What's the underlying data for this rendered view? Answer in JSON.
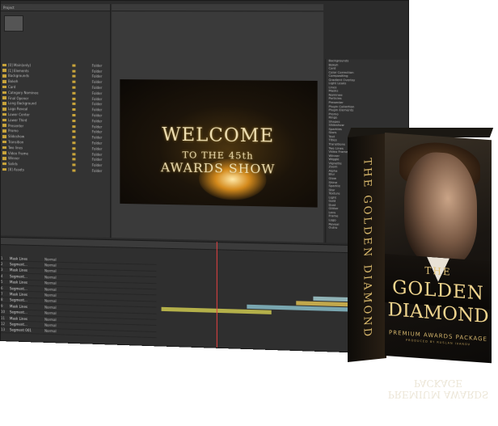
{
  "project_panel": {
    "tab": "Project",
    "columns": [
      "Name",
      "Type",
      "Size"
    ],
    "items": [
      {
        "name": "[0] Main(only)",
        "type": "Folder"
      },
      {
        "name": "[1] Elements",
        "type": "Folder"
      },
      {
        "name": "Backgrounds",
        "type": "Folder"
      },
      {
        "name": "Bokeh",
        "type": "Folder"
      },
      {
        "name": "Card",
        "type": "Folder"
      },
      {
        "name": "Category Nominee",
        "type": "Folder"
      },
      {
        "name": "Final Opener",
        "type": "Folder"
      },
      {
        "name": "Long Background",
        "type": "Folder"
      },
      {
        "name": "Logo Reveal",
        "type": "Folder"
      },
      {
        "name": "Lower Center",
        "type": "Folder"
      },
      {
        "name": "Lower Third",
        "type": "Folder"
      },
      {
        "name": "Presenter",
        "type": "Folder"
      },
      {
        "name": "Promo",
        "type": "Folder"
      },
      {
        "name": "Slideshow",
        "type": "Folder"
      },
      {
        "name": "Transition",
        "type": "Folder"
      },
      {
        "name": "Two lines",
        "type": "Folder"
      },
      {
        "name": "Video Frame",
        "type": "Folder"
      },
      {
        "name": "Winner",
        "type": "Folder"
      },
      {
        "name": "Solids",
        "type": "Folder"
      },
      {
        "name": "[8] Assets",
        "type": "Folder"
      }
    ]
  },
  "composition": {
    "line1": "WELCOME",
    "line2": "TO THE 45th",
    "line3": "AWARDS SHOW"
  },
  "timeline": {
    "columns": [
      "Source Name",
      "Mode",
      "TrkMat",
      "Parent"
    ],
    "layers": [
      {
        "num": "1",
        "name": "Mask Lines",
        "mode": "Normal"
      },
      {
        "num": "2",
        "name": "Segment...",
        "mode": "Normal"
      },
      {
        "num": "3",
        "name": "Mask Lines",
        "mode": "Normal"
      },
      {
        "num": "4",
        "name": "Segment...",
        "mode": "Normal"
      },
      {
        "num": "5",
        "name": "Mask Lines",
        "mode": "Normal"
      },
      {
        "num": "6",
        "name": "Segment...",
        "mode": "Normal"
      },
      {
        "num": "7",
        "name": "Mask Lines",
        "mode": "Normal"
      },
      {
        "num": "8",
        "name": "Segment...",
        "mode": "Normal"
      },
      {
        "num": "9",
        "name": "Mask Lines",
        "mode": "Normal"
      },
      {
        "num": "10",
        "name": "Segment...",
        "mode": "Normal"
      },
      {
        "num": "11",
        "name": "Mask Lines",
        "mode": "Normal"
      },
      {
        "num": "12",
        "name": "Segment...",
        "mode": "Normal"
      },
      {
        "num": "13",
        "name": "Segment 001",
        "mode": "Normal"
      }
    ],
    "track_bars": [
      {
        "start": 0.0,
        "end": 0.45,
        "color": "#b4b04a"
      },
      {
        "start": 0.35,
        "end": 0.9,
        "color": "#79a6b0"
      },
      {
        "start": 0.55,
        "end": 1.0,
        "color": "#c2a84c"
      },
      {
        "start": 0.62,
        "end": 1.0,
        "color": "#8fb2b6"
      }
    ]
  },
  "box": {
    "side": "THE GOLDEN DIAMOND",
    "the": "THE",
    "golden": "GOLDEN",
    "diamond": "DIAMOND",
    "subtitle": "PREMIUM AWARDS PACKAGE",
    "producer": "PRODUCED BY RUSLAN IVANOV"
  },
  "effects_panel": {
    "items": [
      "Backgrounds",
      "Bokeh",
      "Card",
      "Color Correction",
      "Compositing",
      "Gradient Overlay",
      "Light Leaks",
      "Lines",
      "Masks",
      "Nominee",
      "Particles",
      "Presenter",
      "Plugin Collection",
      "Plugin Elements",
      "Promo",
      "Rings",
      "Shapes",
      "Slideshow",
      "Sparkles",
      "Stars",
      "Text",
      "Titles",
      "Transitions",
      "Two Lines",
      "Video Frames",
      "Winner",
      "Wiggle",
      "Vignette",
      "Zoom",
      "Alpha",
      "Blur",
      "Glow",
      "Shine",
      "Sparkle",
      "Star",
      "Texture",
      "Light",
      "Gold",
      "Dust",
      "Glitter",
      "Lens",
      "Frame",
      "Logo",
      "Reveal",
      "Outro"
    ]
  },
  "colors": {
    "accent_gold": "#e3c47a",
    "ui_dark": "#2b2b2b"
  }
}
